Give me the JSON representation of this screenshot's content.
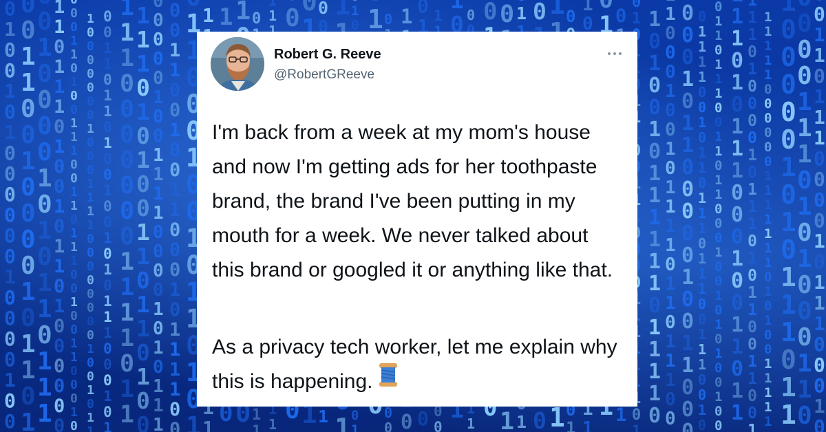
{
  "tweet": {
    "author_name": "Robert G. Reeve",
    "author_handle": "@RobertGReeve",
    "paragraphs": [
      "I'm back from a week at my mom's house and now I'm getting ads for her toothpaste brand, the brand I've been putting in my mouth for a week. We never talked about this brand or googled it or anything like that.",
      "As a privacy tech worker, let me explain why this is happening."
    ],
    "thread_emoji_icon": "spool-of-thread-icon",
    "more_icon": "more-options-icon"
  },
  "background": {
    "pattern": "binary-code",
    "colors": [
      "#0b3aa8",
      "#1e6cf0",
      "#8fd0ff"
    ]
  }
}
